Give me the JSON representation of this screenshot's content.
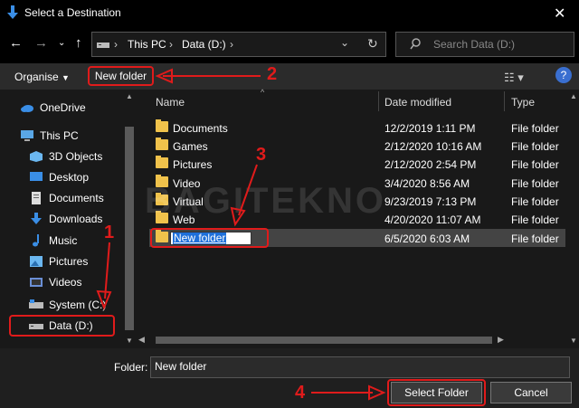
{
  "window": {
    "title": "Select a Destination"
  },
  "address": {
    "crumbs": [
      "This PC",
      "Data (D:)"
    ]
  },
  "search": {
    "placeholder": "Search Data (D:)"
  },
  "toolbar": {
    "organise_label": "Organise",
    "new_folder_label": "New folder"
  },
  "sidebar": {
    "items": [
      {
        "label": "OneDrive",
        "icon": "cloud-icon"
      },
      {
        "label": "This PC",
        "icon": "computer-icon"
      },
      {
        "label": "3D Objects",
        "icon": "cube-icon"
      },
      {
        "label": "Desktop",
        "icon": "desktop-icon"
      },
      {
        "label": "Documents",
        "icon": "document-icon"
      },
      {
        "label": "Downloads",
        "icon": "download-icon"
      },
      {
        "label": "Music",
        "icon": "music-icon"
      },
      {
        "label": "Pictures",
        "icon": "picture-icon"
      },
      {
        "label": "Videos",
        "icon": "video-icon"
      },
      {
        "label": "System (C:)",
        "icon": "drive-icon"
      },
      {
        "label": "Data (D:)",
        "icon": "drive-icon"
      }
    ]
  },
  "columns": {
    "name": "Name",
    "date": "Date modified",
    "type": "Type"
  },
  "files": [
    {
      "name": "Documents",
      "date": "12/2/2019 1:11 PM",
      "type": "File folder"
    },
    {
      "name": "Games",
      "date": "2/12/2020 10:16 AM",
      "type": "File folder"
    },
    {
      "name": "Pictures",
      "date": "2/12/2020 2:54 PM",
      "type": "File folder"
    },
    {
      "name": "Video",
      "date": "3/4/2020 8:56 AM",
      "type": "File folder"
    },
    {
      "name": "Virtual",
      "date": "9/23/2019 7:13 PM",
      "type": "File folder"
    },
    {
      "name": "Web",
      "date": "4/20/2020 11:07 AM",
      "type": "File folder"
    },
    {
      "name": "New folder",
      "date": "6/5/2020 6:03 AM",
      "type": "File folder"
    }
  ],
  "footer": {
    "folder_label": "Folder:",
    "folder_value": "New folder",
    "select_label": "Select Folder",
    "cancel_label": "Cancel"
  },
  "annotations": [
    "1",
    "2",
    "3",
    "4"
  ],
  "watermark": "BAGITEKNO",
  "colors": {
    "annotation": "#e01b1b",
    "selection": "#1e6fd9",
    "folder": "#f0c24b"
  }
}
